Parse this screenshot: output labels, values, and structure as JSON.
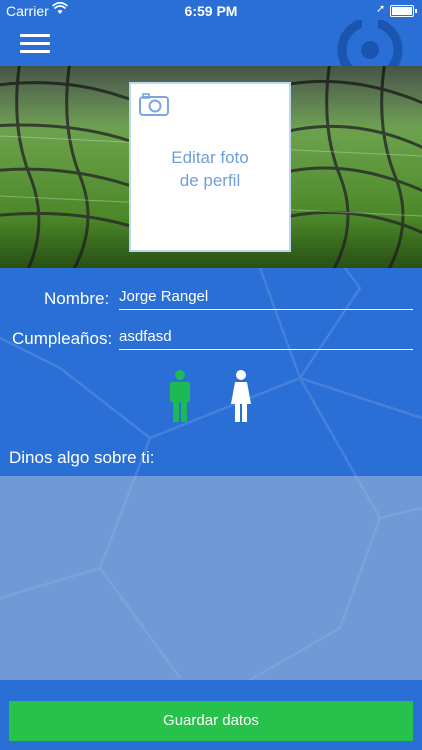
{
  "status_bar": {
    "carrier": "Carrier",
    "time": "6:59 PM"
  },
  "profile": {
    "photo_label": "Editar foto de perfil"
  },
  "form": {
    "name_label": "Nombre:",
    "name_value": "Jorge Rangel",
    "birthday_label": "Cumpleaños:",
    "birthday_value": "asdfasd",
    "gender_options": [
      "male",
      "female"
    ],
    "gender_selected": "male",
    "about_label": "Dinos algo sobre ti:",
    "about_value": ""
  },
  "actions": {
    "save_label": "Guardar datos"
  },
  "colors": {
    "primary": "#2a6fd6",
    "accent_green": "#27c24c",
    "selected_gender": "#1db954",
    "unselected_gender": "#ffffff"
  }
}
